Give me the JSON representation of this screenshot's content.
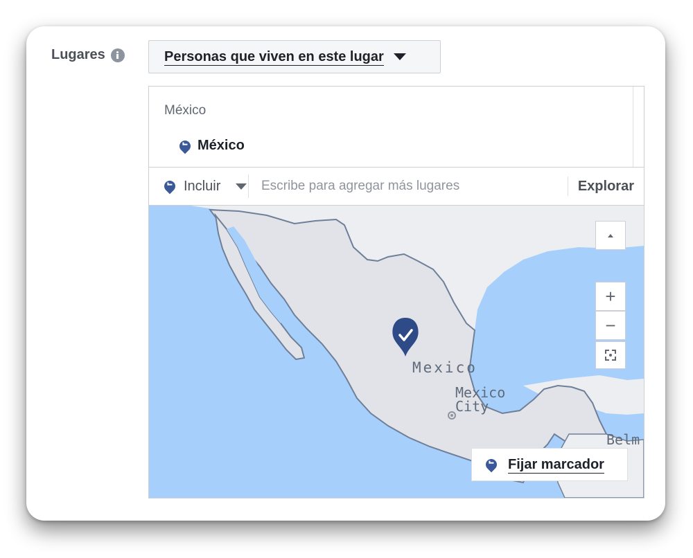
{
  "targeting": {
    "label": "Lugares",
    "audience_dropdown": "Personas que viven en este lugar",
    "selected_group_label": "México",
    "selected_items": [
      {
        "name": "México"
      }
    ],
    "include_mode": "Incluir",
    "search_placeholder": "Escribe para agregar más lugares",
    "explore_label": "Explorar"
  },
  "map": {
    "labels": {
      "country": "Mexico",
      "city_line1": "Mexico",
      "city_line2": "City",
      "edge": "Belm"
    },
    "controls": {
      "zoom_in": "+",
      "zoom_out": "−"
    },
    "drop_pin_label": "Fijar marcador"
  },
  "colors": {
    "accent": "#3b5998",
    "water": "#a6d0fb",
    "land": "#e1e3e8"
  }
}
